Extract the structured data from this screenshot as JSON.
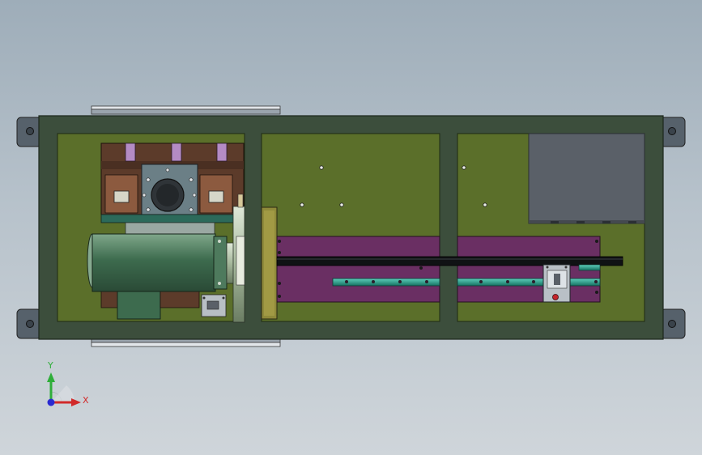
{
  "viewport": {
    "background_top": "#9eadb9",
    "background_bottom": "#cfd5da"
  },
  "model": {
    "frame_color": "#3c4e3c",
    "panel_color": "#5b6f2a",
    "plate_color": "#6a2f63",
    "rail_color": "#1f8f7d",
    "motor_color": "#3d6b4e",
    "block_color": "#5a6068",
    "bracket_color": "#5c3b2a"
  },
  "triad": {
    "x_label": "X",
    "y_label": "Y",
    "x_color": "#d12a2a",
    "y_color": "#2fae3a",
    "z_color": "#2a2ad1"
  }
}
